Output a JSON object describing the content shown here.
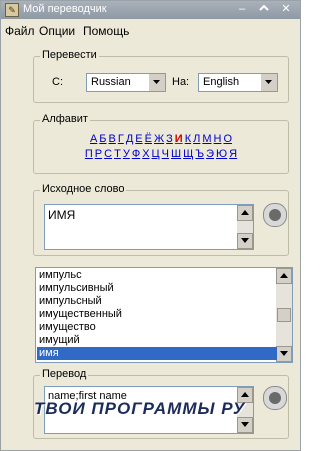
{
  "window": {
    "title": "Мой переводчик"
  },
  "menu": [
    "Файл",
    "Опции",
    "Помощь"
  ],
  "translate_group": {
    "legend": "Перевести",
    "from_label": "С:",
    "from_value": "Russian",
    "to_label": "На:",
    "to_value": "English"
  },
  "alphabet": {
    "legend": "Алфавит",
    "row1": [
      "А",
      "Б",
      "В",
      "Г",
      "Д",
      "Е",
      "Ё",
      "Ж",
      "З",
      "И",
      "К",
      "Л",
      "М",
      "Н",
      "О"
    ],
    "row2": [
      "П",
      "Р",
      "С",
      "Т",
      "У",
      "Ф",
      "Х",
      "Ц",
      "Ч",
      "Ш",
      "Щ",
      "Ъ",
      "Э",
      "Ю",
      "Я"
    ],
    "active": "И"
  },
  "source": {
    "legend": "Исходное слово",
    "value": "ИМЯ"
  },
  "wordlist": {
    "items": [
      "импульс",
      "импульсивный",
      "импульсный",
      "имущественный",
      "имущество",
      "имущий",
      "имя"
    ],
    "selected": "имя"
  },
  "translation": {
    "legend": "Перевод",
    "value": "name;first name"
  },
  "watermark": "ТВОИ ПРОГРАММЫ РУ"
}
